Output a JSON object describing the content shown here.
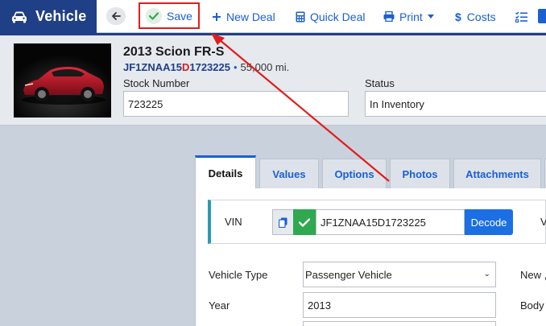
{
  "brand": {
    "title": "Vehicle",
    "icon": "car-icon"
  },
  "toolbar": {
    "back_icon": "arrow-left-icon",
    "save_label": "Save",
    "new_deal_label": "New Deal",
    "quick_deal_label": "Quick Deal",
    "print_label": "Print",
    "costs_label": "Costs"
  },
  "vehicle": {
    "title": "2013 Scion FR-S",
    "vin_prefix": "JF1ZNAA15",
    "vin_highlight": "D",
    "vin_suffix": "1723225",
    "bullet": "•",
    "mileage": "55,000 mi.",
    "stock_label": "Stock Number",
    "stock_value": "723225",
    "status_label": "Status",
    "status_value": "In Inventory"
  },
  "tabs": [
    {
      "label": "Details",
      "active": true
    },
    {
      "label": "Values",
      "active": false
    },
    {
      "label": "Options",
      "active": false
    },
    {
      "label": "Photos",
      "active": false
    },
    {
      "label": "Attachments",
      "active": false
    }
  ],
  "details": {
    "vin_label": "VIN",
    "vin_value": "JF1ZNAA15D1723225",
    "decode_label": "Decode",
    "right_cut_label": "V",
    "vehicle_type_label": "Vehicle Type",
    "vehicle_type_value": "Passenger Vehicle",
    "new_cut_label": "New ,",
    "year_label": "Year",
    "year_value": "2013",
    "body_cut_label": "Body"
  },
  "colors": {
    "brand": "#1f3f86",
    "accent": "#1b5fd0",
    "annotation": "#e21d1d",
    "success": "#2fa84f",
    "vin_bar": "#2a9bb2"
  }
}
